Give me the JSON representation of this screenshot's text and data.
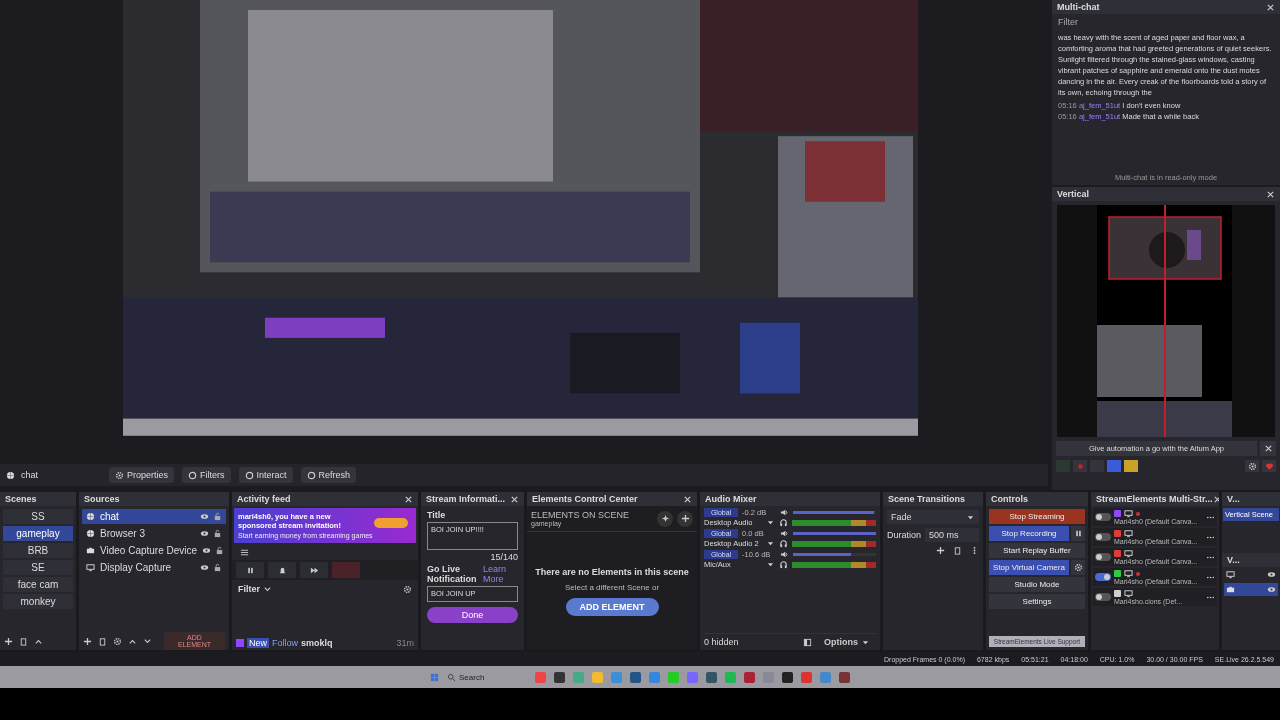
{
  "multichat": {
    "title": "Multi-chat",
    "filter": "Filter",
    "paragraph": "was heavy with the scent of aged paper and floor wax, a comforting aroma that had greeted generations of quiet seekers. Sunlight filtered through the stained-glass windows, casting vibrant patches of sapphire and emerald onto the dust motes dancing in the air. Every creak of the floorboards told a story of its own, echoing through the",
    "messages": [
      {
        "time": "05:16",
        "user": "aj_fem_51ut",
        "text": "I don't even know"
      },
      {
        "time": "05:16",
        "user": "aj_fem_51ut",
        "text": "Made that a while back"
      }
    ],
    "footer": "Multi-chat is in read-only mode"
  },
  "vertical": {
    "title": "Vertical",
    "banner": "Give automation a go with the Aitum App"
  },
  "context_bar": {
    "source": "chat",
    "buttons": [
      "Properties",
      "Filters",
      "Interact",
      "Refresh"
    ]
  },
  "scenes": {
    "title": "Scenes",
    "items": [
      {
        "name": "SS",
        "selected": false
      },
      {
        "name": "gameplay",
        "selected": true
      },
      {
        "name": "BRB",
        "selected": false
      },
      {
        "name": "SE",
        "selected": false
      },
      {
        "name": "face cam",
        "selected": false
      },
      {
        "name": "monkey",
        "selected": false
      }
    ]
  },
  "sources": {
    "title": "Sources",
    "add_button": "ADD ELEMENT",
    "items": [
      {
        "name": "chat",
        "kind": "browser",
        "selected": true
      },
      {
        "name": "Browser 3",
        "kind": "browser",
        "selected": false
      },
      {
        "name": "Video Capture Device",
        "kind": "camera",
        "selected": false
      },
      {
        "name": "Display Capture",
        "kind": "display",
        "selected": false
      }
    ]
  },
  "activity": {
    "title": "Activity feed",
    "banner": "mari4sh0, you have a new sponsored stream invitation!",
    "banner_sub": "Start earning money from streaming games",
    "filter": "Filter",
    "events": [
      {
        "badge": "New",
        "type": "Follow",
        "user": "smoklq",
        "time": "31m"
      }
    ]
  },
  "stream_info": {
    "title": "Stream Informati...",
    "title_label": "Title",
    "title_value": "BOI JOIN UP!!!!",
    "count": "15/140",
    "notif_label": "Go Live Notification",
    "learn_more": "Learn More",
    "notif_value": "BOI JOIN UP",
    "done": "Done"
  },
  "elements": {
    "title": "Elements Control Center",
    "heading": "ELEMENTS ON SCENE",
    "scene": "gameplay",
    "empty": "There are no Elements in this scene",
    "hint": "Select a different Scene or",
    "button": "ADD ELEMENT"
  },
  "mixer": {
    "title": "Audio Mixer",
    "hidden": "0 hidden",
    "options": "Options",
    "channels": [
      {
        "name": "Desktop Audio",
        "reading": "-0.2 dB",
        "mode": "Global",
        "level": 0.97
      },
      {
        "name": "Desktop Audio 2",
        "reading": "0.0 dB",
        "mode": "Global",
        "level": 1.0
      },
      {
        "name": "Mic/Aux",
        "reading": "-10.6 dB",
        "mode": "Global",
        "level": 0.7
      }
    ]
  },
  "transitions": {
    "title": "Scene Transitions",
    "transition": "Fade",
    "duration_label": "Duration",
    "duration": "500 ms"
  },
  "controls": {
    "title": "Controls",
    "buttons": [
      {
        "label": "Stop Streaming",
        "kind": "streaming"
      },
      {
        "label": "Stop Recording",
        "kind": "recording"
      },
      {
        "label": "Start Replay Buffer",
        "kind": "plain"
      },
      {
        "label": "Stop Virtual Camera",
        "kind": "virtualcam"
      },
      {
        "label": "Studio Mode",
        "kind": "plain"
      },
      {
        "label": "Settings",
        "kind": "plain"
      }
    ],
    "support": "StreamElements Live Support"
  },
  "multistream": {
    "title": "StreamElements Multi-Str...",
    "rows": [
      {
        "name": "Mari4sh0 (Default Canva...",
        "on": false,
        "color": "#9146ff",
        "dot": true
      },
      {
        "name": "Mari4sho (Default Canva...",
        "on": false,
        "color": "#e03a3a",
        "dot": false
      },
      {
        "name": "Mari4sho (Default Canva...",
        "on": false,
        "color": "#e03a3a",
        "dot": false
      },
      {
        "name": "Mari4sho (Default Canva...",
        "on": true,
        "color": "#2ecc40",
        "dot": true
      },
      {
        "name": "Mari4sho.cions (Def...",
        "on": false,
        "color": "#cfcfcf",
        "dot": false
      }
    ]
  },
  "vscene": {
    "title": "V...",
    "scenes": [
      {
        "name": "Vertical Scene",
        "selected": true
      }
    ],
    "title2": "V...",
    "sources": [
      {
        "kind": "display",
        "selected": false
      },
      {
        "kind": "camera",
        "selected": true
      }
    ]
  },
  "status": [
    "Dropped Frames 0 (0.0%)",
    "6782 kbps",
    "05:51:21",
    "04:18:00",
    "CPU: 1.0%",
    "30.00 / 30.00 FPS",
    "SE.Live 26.2.5.549"
  ],
  "taskbar": {
    "search": "Search"
  }
}
